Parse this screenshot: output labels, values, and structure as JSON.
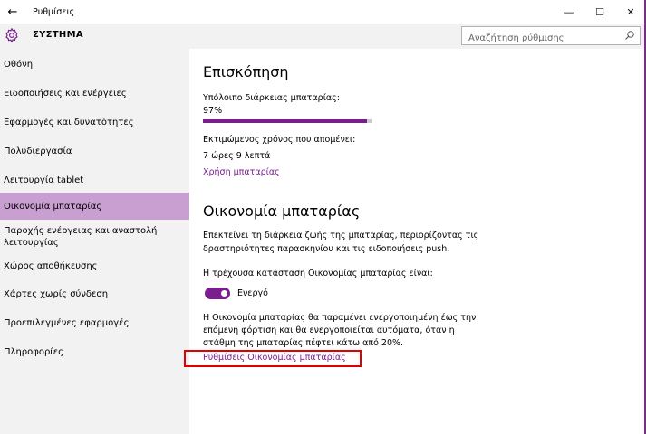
{
  "window": {
    "title": "Ρυθμίσεις",
    "back_glyph": "←",
    "minimize_glyph": "—",
    "maximize_glyph": "☐",
    "close_glyph": "✕"
  },
  "header": {
    "section_title": "ΣΥΣΤΗΜΑ",
    "search_placeholder": "Αναζήτηση ρύθμισης"
  },
  "sidebar": {
    "items": [
      {
        "label": "Οθόνη"
      },
      {
        "label": "Ειδοποιήσεις και ενέργειες"
      },
      {
        "label": "Εφαρμογές και δυνατότητες"
      },
      {
        "label": "Πολυδιεργασία"
      },
      {
        "label": "Λειτουργία tablet"
      },
      {
        "label": "Οικονομία μπαταρίας",
        "selected": true
      },
      {
        "label_line1": "Παροχής ενέργειας και αναστολή",
        "label_line2": "λειτουργίας"
      },
      {
        "label": "Χώρος αποθήκευσης"
      },
      {
        "label": "Χάρτες χωρίς σύνδεση"
      },
      {
        "label": "Προεπιλεγμένες εφαρμογές"
      },
      {
        "label": "Πληροφορίες"
      }
    ]
  },
  "overview": {
    "heading": "Επισκόπηση",
    "remaining_label": "Υπόλοιπο διάρκειας μπαταρίας:",
    "remaining_value": "97%",
    "remaining_fraction": 0.97,
    "estimated_label": "Εκτιμώμενος χρόνος που απομένει:",
    "estimated_value": "7 ώρες 9 λεπτά",
    "usage_link": "Χρήση μπαταρίας"
  },
  "battery_saver": {
    "heading": "Οικονομία μπαταρίας",
    "desc_line1": "Επεκτείνει τη διάρκεια ζωής της μπαταρίας, περιορίζοντας τις",
    "desc_line2": "δραστηριότητες παρασκηνίου και τις ειδοποιήσεις push.",
    "status_label": "Η τρέχουσα κατάσταση Οικονομίας μπαταρίας είναι:",
    "toggle_state": "Ενεργό",
    "note_line1": "Η Οικονομία μπαταρίας θα παραμένει ενεργοποιημένη έως την",
    "note_line2": "επόμενη φόρτιση και θα ενεργοποιείται αυτόματα, όταν η",
    "note_line3": "στάθμη της μπαταρίας πέφτει κάτω από 20%.",
    "settings_link": "Ρυθμίσεις Οικονομίας μπαταρίας"
  },
  "colors": {
    "accent": "#7a1d8f",
    "selected_nav": "#c99fd1",
    "sidebar_bg": "#f2f2f2",
    "highlight_box": "#e00000"
  }
}
